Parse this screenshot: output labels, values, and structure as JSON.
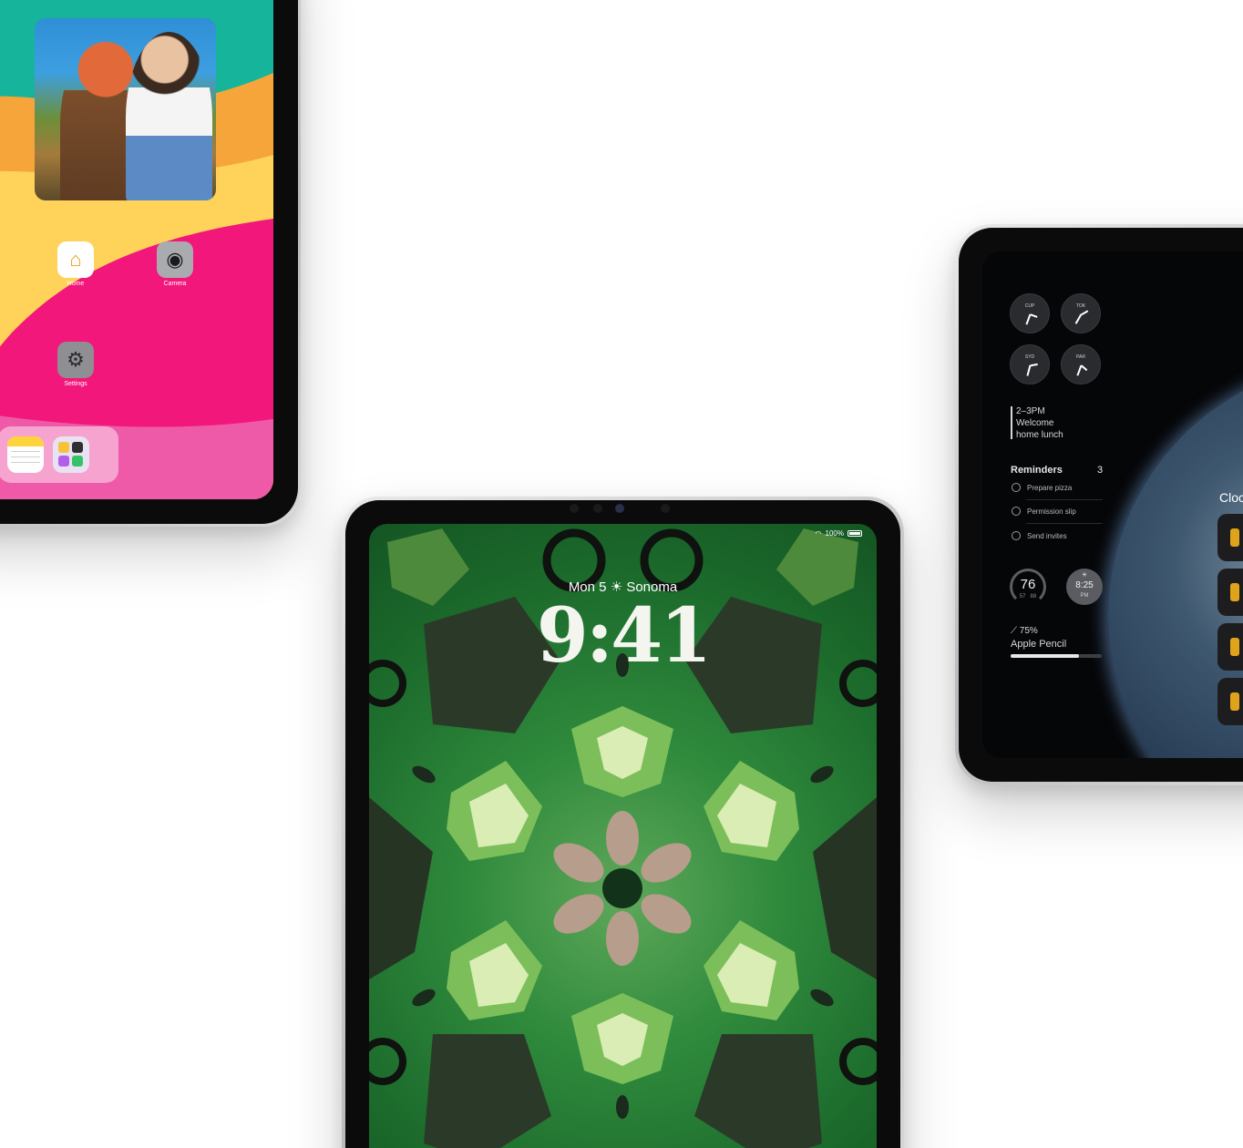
{
  "home_ipad": {
    "apps": [
      {
        "label": "Home",
        "icon": "house-icon"
      },
      {
        "label": "Camera",
        "icon": "camera-icon"
      },
      {
        "label": "Settings",
        "icon": "gear-icon"
      }
    ],
    "dock": [
      "notes-icon",
      "app-folder-icon"
    ]
  },
  "lock_ipad": {
    "status": {
      "battery_text": "100%"
    },
    "date_weather": "Mon 5",
    "location": "Sonoma",
    "time": "9:41"
  },
  "widgets_ipad": {
    "world_clocks": [
      {
        "code": "CUP"
      },
      {
        "code": "TOK"
      },
      {
        "code": "SYD"
      },
      {
        "code": "PAR"
      }
    ],
    "calendar": {
      "time_range": "2–3PM",
      "line1": "Welcome",
      "line2": "home lunch"
    },
    "reminders": {
      "title": "Reminders",
      "count": "3",
      "items": [
        "Prepare pizza",
        "Permission slip",
        "Send invites"
      ]
    },
    "weather": {
      "temp": "76",
      "low": "57",
      "high": "88"
    },
    "sunset": {
      "time": "8:25",
      "period": "PM"
    },
    "pencil": {
      "percent": "75%",
      "label": "Apple Pencil",
      "level": 0.75
    },
    "clock_app_partial": "Cloc"
  },
  "colors": {
    "lock_green": "#1c6b2c",
    "gem_light": "#c9e6a0",
    "accent_orange": "#e0a31c"
  }
}
